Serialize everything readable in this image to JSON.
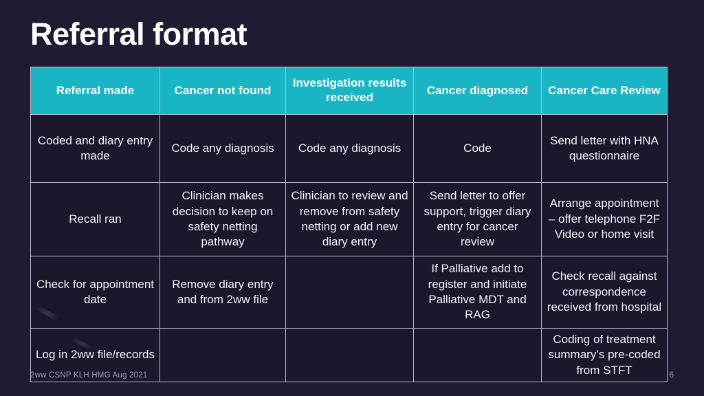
{
  "slide": {
    "title": "Referral format",
    "footer_note": "2ww CSNP KLH HMG Aug 2021",
    "page_number": "6"
  },
  "colors": {
    "background": "#1e1b33",
    "header_accent": "#1ab5c4",
    "cell_background": "#1b182c",
    "border": "#b9b6cb",
    "text": "#ffffff",
    "footer_text": "#9d9ab2"
  },
  "table": {
    "headers": [
      "Referral made",
      "Cancer not found",
      "Investigation results received",
      "Cancer diagnosed",
      "Cancer Care Review"
    ],
    "rows": [
      [
        "Coded and diary entry made",
        "Code any diagnosis",
        "Code any diagnosis",
        "Code",
        "Send letter with HNA questionnaire"
      ],
      [
        "Recall ran",
        "Clinician makes decision to keep on safety netting pathway",
        "Clinician to review and remove from safety netting or add new diary entry",
        "Send letter to offer support, trigger diary entry for cancer review",
        "Arrange appointment – offer telephone F2F Video or home visit"
      ],
      [
        "Check for appointment date",
        "Remove diary entry and from 2ww file",
        "",
        "If Palliative add to register and initiate Palliative MDT and RAG",
        "Check recall against correspondence received from hospital"
      ],
      [
        "Log in 2ww file/records",
        "",
        "",
        "",
        "Coding of treatment summary’s pre-coded from STFT"
      ]
    ]
  }
}
